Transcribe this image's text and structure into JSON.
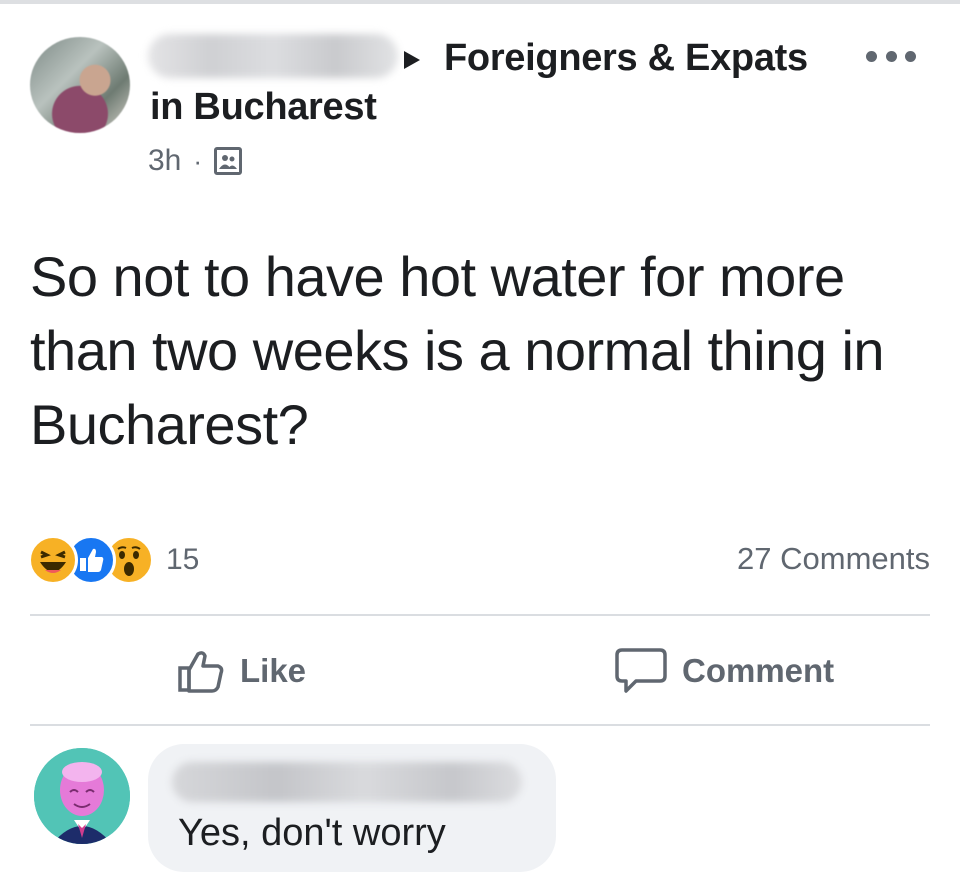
{
  "post": {
    "group_name": "Foreigners & Expats",
    "group_name_line2": "in Bucharest",
    "time": "3h",
    "separator": "·",
    "privacy_icon": "group-icon",
    "text": "So not to have hot water for more than two weeks is a normal thing in Bucharest?"
  },
  "reactions": {
    "types": [
      "haha",
      "like",
      "wow"
    ],
    "count": "15",
    "comments": "27 Comments"
  },
  "actions": {
    "like_label": "Like",
    "comment_label": "Comment"
  },
  "comment": {
    "text": "Yes, don't worry"
  },
  "colors": {
    "like_blue": "#1877f2",
    "reaction_yellow": "#f7b125",
    "secondary_text": "#606770",
    "bubble_bg": "#f0f2f5"
  }
}
